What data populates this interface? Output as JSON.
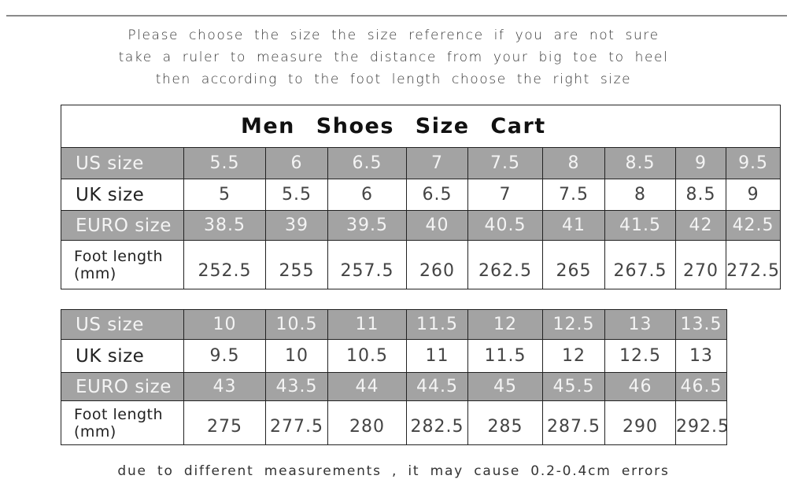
{
  "intro_lines": [
    "Please choose the size the size reference if  you  are  not  sure",
    "take  a  ruler  to  measure  the  distance  from  your  big  toe  to  heel",
    "then   according   to   the  foot  length   choose   the  right  size"
  ],
  "table1": {
    "title": "Men  Shoes  Size  Cart",
    "rows": [
      {
        "label": "US size",
        "values": [
          "5.5",
          "6",
          "6.5",
          "7",
          "7.5",
          "8",
          "8.5",
          "9",
          "9.5"
        ]
      },
      {
        "label": "UK size",
        "values": [
          "5",
          "5.5",
          "6",
          "6.5",
          "7",
          "7.5",
          "8",
          "8.5",
          "9"
        ]
      },
      {
        "label": "EURO size",
        "values": [
          "38.5",
          "39",
          "39.5",
          "40",
          "40.5",
          "41",
          "41.5",
          "42",
          "42.5"
        ]
      },
      {
        "label_line1": "Foot length",
        "label_line2": "(mm)",
        "values": [
          "252.5",
          "255",
          "257.5",
          "260",
          "262.5",
          "265",
          "267.5",
          "270",
          "272.5"
        ]
      }
    ]
  },
  "table2": {
    "rows": [
      {
        "label": "US size",
        "values": [
          "10",
          "10.5",
          "11",
          "11.5",
          "12",
          "12.5",
          "13",
          "13.5"
        ]
      },
      {
        "label": "UK size",
        "values": [
          "9.5",
          "10",
          "10.5",
          "11",
          "11.5",
          "12",
          "12.5",
          "13"
        ]
      },
      {
        "label": "EURO size",
        "values": [
          "43",
          "43.5",
          "44",
          "44.5",
          "45",
          "45.5",
          "46",
          "46.5"
        ]
      },
      {
        "label_line1": "Foot length",
        "label_line2": "(mm)",
        "values": [
          "275",
          "277.5",
          "280",
          "282.5",
          "285",
          "287.5",
          "290",
          "292.5"
        ]
      }
    ]
  },
  "footnote": "due  to  different  measurements , it  may  cause  0.2-0.4cm  errors",
  "colors": {
    "header_row_bg": "#a3a3a3",
    "header_row_text": "#f4f4f4",
    "border": "#222222"
  }
}
